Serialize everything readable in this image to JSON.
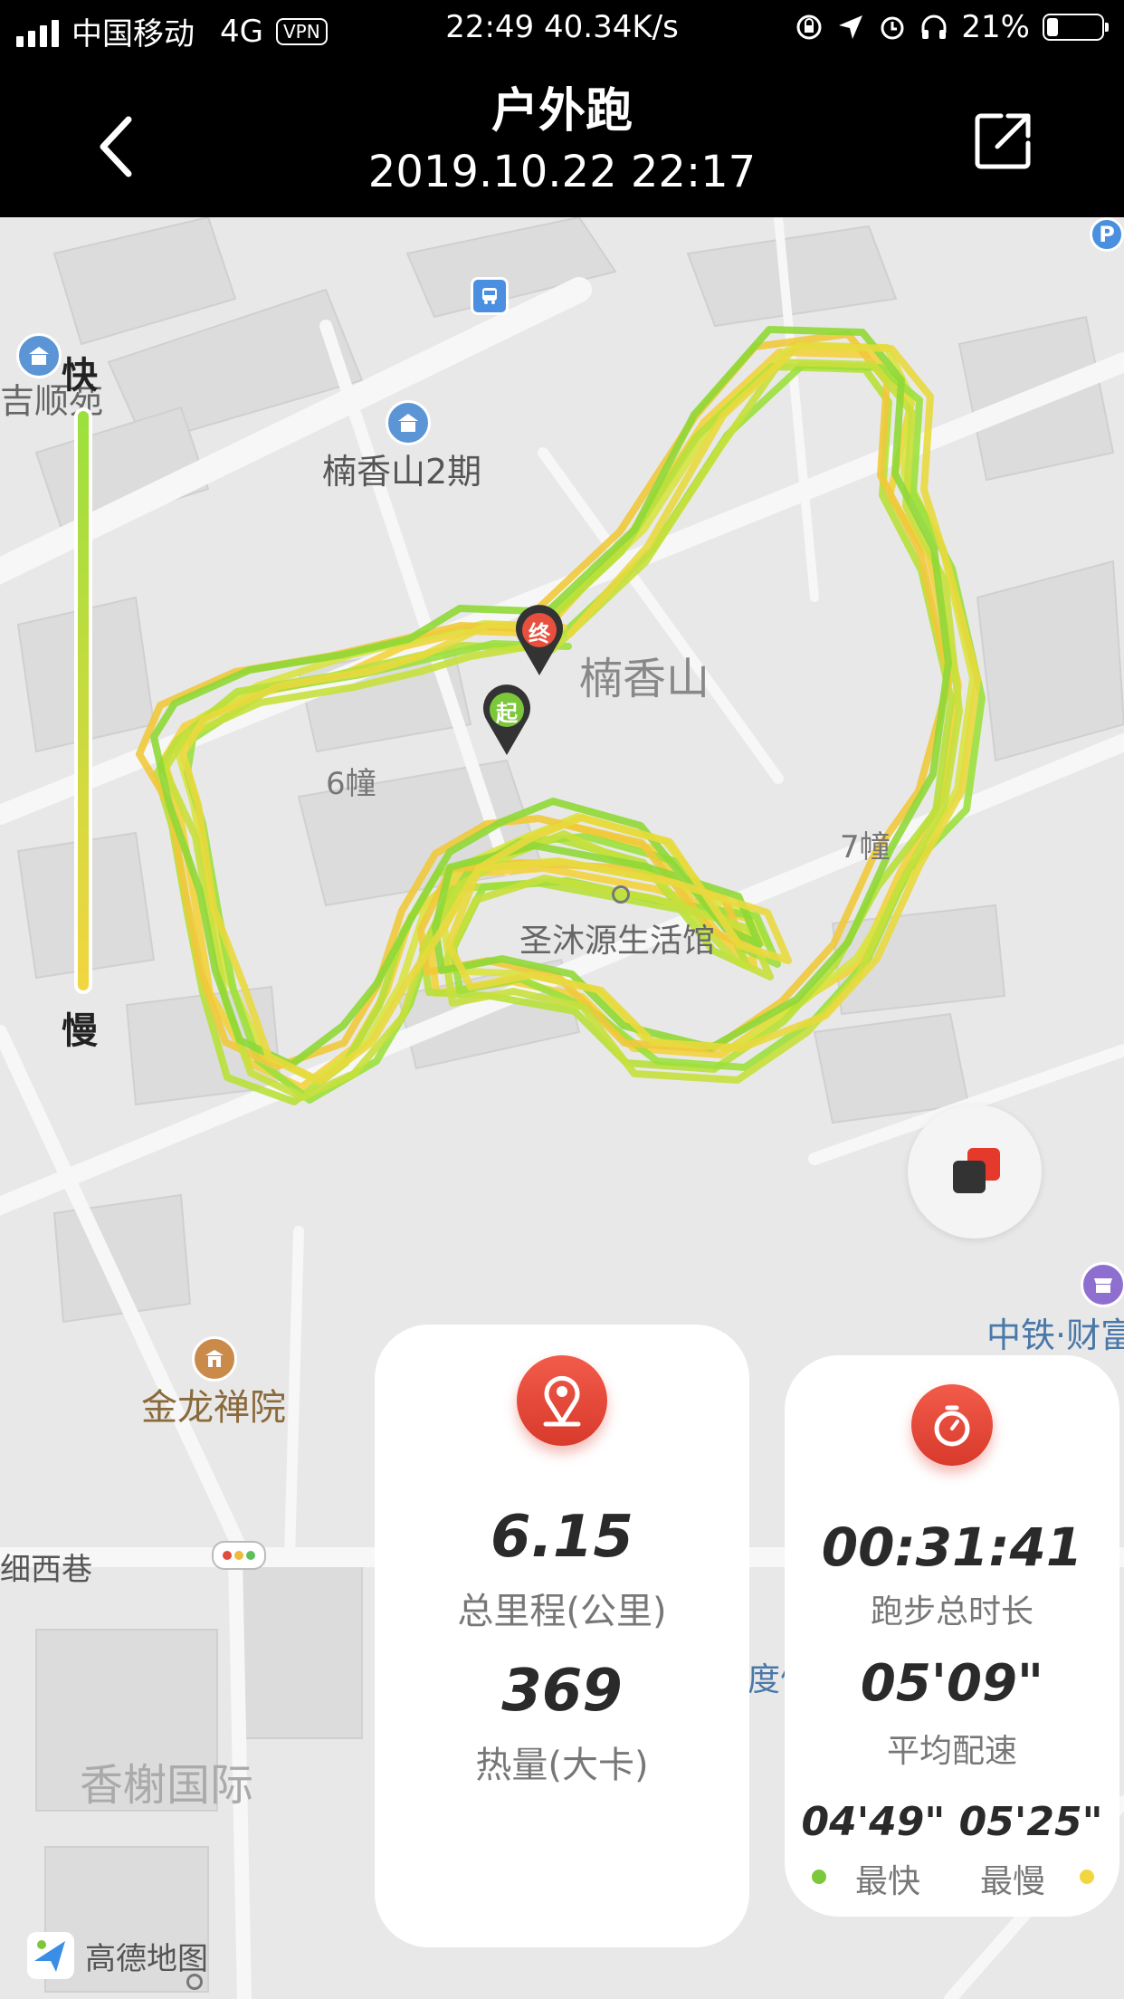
{
  "status_bar": {
    "carrier": "中国移动",
    "network": "4G",
    "vpn": "VPN",
    "time_speed": "22:49 40.34K/s",
    "battery_percent": "21%",
    "battery_level": 0.21,
    "icons": [
      "lock-rotation-icon",
      "location-arrow-icon",
      "alarm-icon",
      "headphones-icon"
    ]
  },
  "nav": {
    "title": "户外跑",
    "subtitle": "2019.10.22 22:17",
    "back_icon": "chevron-left-icon",
    "share_icon": "share-icon"
  },
  "map": {
    "labels": {
      "jishunyuan": "吉顺苑",
      "nanxiangshan2": "楠香山2期",
      "nanxiangshan": "楠香山",
      "building6": "6幢",
      "shengmu": "圣沐源生活馆",
      "jinlong": "金龙禅院",
      "zhongtie": "中铁·财富",
      "street": "细西巷",
      "xiangshu": "香榭国际",
      "du": "度假",
      "seven": "7幢"
    },
    "markers": {
      "start": "起",
      "end": "终"
    },
    "speed_legend": {
      "fast": "快",
      "slow": "慢",
      "fast_color": "#9be03d",
      "slow_color": "#f2d640"
    },
    "logo": "高德地图"
  },
  "stats": {
    "distance": "6.15",
    "distance_label": "总里程(公里)",
    "calories": "369",
    "calories_label": "热量(大卡)",
    "duration": "00:31:41",
    "duration_label": "跑步总时长",
    "avg_pace": "05'09\"",
    "avg_pace_label": "平均配速",
    "fastest_slowest": "04'49\" 05'25\"",
    "fastest_label": "最快",
    "slowest_label": "最慢"
  },
  "colors": {
    "accent": "#e64a36",
    "fast": "#9be03d",
    "slow": "#f2d640"
  }
}
